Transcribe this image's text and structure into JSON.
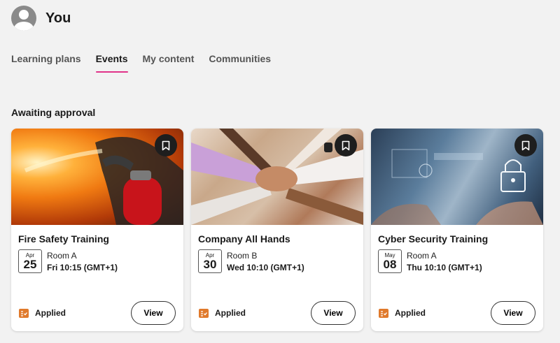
{
  "header": {
    "title": "You",
    "avatar_icon": "user-avatar-icon"
  },
  "tabs": [
    {
      "label": "Learning plans",
      "active": false
    },
    {
      "label": "Events",
      "active": true
    },
    {
      "label": "My content",
      "active": false
    },
    {
      "label": "Communities",
      "active": false
    }
  ],
  "accent_color": "#e0338a",
  "section": {
    "title": "Awaiting approval"
  },
  "cards": [
    {
      "title": "Fire Safety Training",
      "month": "Apr",
      "day": "25",
      "room": "Room A",
      "time": "Fri 10:15 (GMT+1)",
      "status": "Applied",
      "view_label": "View",
      "image": "fire-extinguisher-photo"
    },
    {
      "title": "Company All Hands",
      "month": "Apr",
      "day": "30",
      "room": "Room B",
      "time": "Wed 10:10 (GMT+1)",
      "status": "Applied",
      "view_label": "View",
      "image": "hands-together-photo"
    },
    {
      "title": "Cyber Security Training",
      "month": "May",
      "day": "08",
      "room": "Room A",
      "time": "Thu 10:10 (GMT+1)",
      "status": "Applied",
      "view_label": "View",
      "image": "cyber-security-lock-photo"
    }
  ],
  "status_color": "#e07a2c"
}
